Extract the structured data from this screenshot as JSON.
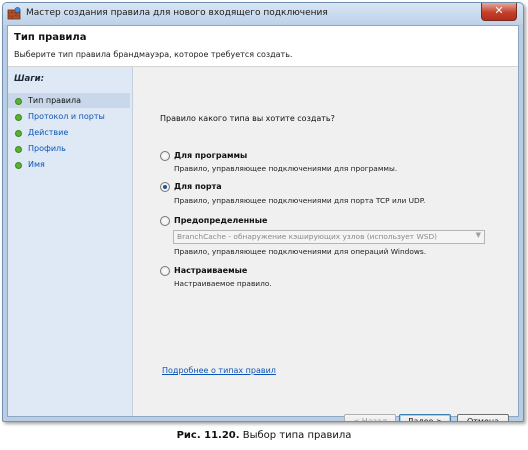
{
  "window": {
    "title": "Мастер создания правила для нового входящего подключения",
    "close_glyph": "✕"
  },
  "header": {
    "title": "Тип правила",
    "subtitle": "Выберите тип правила брандмауэра, которое требуется создать."
  },
  "sidebar": {
    "heading": "Шаги:",
    "steps": [
      {
        "label": "Тип правила",
        "active": true
      },
      {
        "label": "Протокол и порты",
        "active": false
      },
      {
        "label": "Действие",
        "active": false
      },
      {
        "label": "Профиль",
        "active": false
      },
      {
        "label": "Имя",
        "active": false
      }
    ]
  },
  "main": {
    "question": "Правило какого типа вы хотите создать?",
    "options": [
      {
        "title": "Для программы",
        "description": "Правило, управляющее подключениями для программы.",
        "selected": false
      },
      {
        "title": "Для порта",
        "description": "Правило, управляющее подключениями для порта TCP или UDP.",
        "selected": true
      },
      {
        "title": "Предопределенные",
        "select_value": "BranchCache - обнаружение кэширующих узлов (использует WSD)",
        "description": "Правило, управляющее подключениями для операций Windows.",
        "selected": false
      },
      {
        "title": "Настраиваемые",
        "description": "Настраиваемое правило.",
        "selected": false
      }
    ],
    "more_link": "Подробнее о типах правил"
  },
  "buttons": {
    "back": "< Назад",
    "next": "Далее >",
    "cancel": "Отмена"
  },
  "caption": {
    "label": "Рис. 11.20.",
    "text": "Выбор типа правила"
  },
  "colors": {
    "link": "#0b54b8",
    "step_dot": "#58b232",
    "sidebar_bg": "#dfe9f5",
    "title_bar": "#bcd1e8"
  }
}
